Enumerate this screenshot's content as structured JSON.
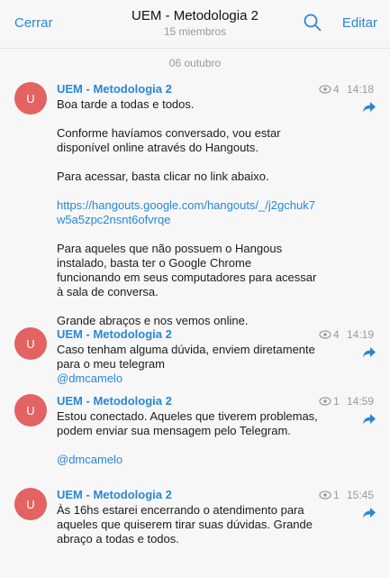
{
  "header": {
    "close_label": "Cerrar",
    "title": "UEM - Metodologia 2",
    "subtitle": "15 miembros",
    "edit_label": "Editar"
  },
  "date_separator": "06 outubro",
  "messages": [
    {
      "avatar_letter": "U",
      "author": "UEM - Metodologia 2",
      "views": "4",
      "time": "14:18",
      "p1": "Boa tarde a todas e todos.",
      "p2": "Conforme havíamos conversado, vou estar disponível online através do Hangouts.",
      "p3": "Para acessar, basta clicar no link abaixo.",
      "link": "https://hangouts.google.com/hangouts/_/j2gchuk7w5a5zpc2nsnt6ofvrqe",
      "p4": "Para aqueles que não possuem o Hangous instalado, basta ter o Google Chrome funcionando em seus computadores para acessar à sala de conversa.",
      "p5": "Grande abraços e nos vemos online."
    },
    {
      "avatar_letter": "U",
      "author": "UEM - Metodologia 2",
      "views": "4",
      "time": "14:19",
      "p1": "Caso tenham alguma dúvida, enviem diretamente para o meu telegram",
      "mention": "@dmcamelo"
    },
    {
      "avatar_letter": "U",
      "author": "UEM - Metodologia 2",
      "views": "1",
      "time": "14:59",
      "p1": "Estou conectado. Aqueles que tiverem problemas, podem enviar sua mensagem pelo Telegram.",
      "mention": "@dmcamelo"
    },
    {
      "avatar_letter": "U",
      "author": "UEM - Metodologia 2",
      "views": "1",
      "time": "15:45",
      "p1": "Às 16hs estarei encerrando o atendimento para aqueles que quiserem tirar suas dúvidas. Grande abraço a todas e todos."
    }
  ],
  "colors": {
    "accent": "#2b87d3",
    "avatar": "#e26361",
    "muted": "#9a9a9e"
  },
  "icons": {
    "search": "search-icon",
    "eye": "eye-icon",
    "share": "share-icon"
  }
}
